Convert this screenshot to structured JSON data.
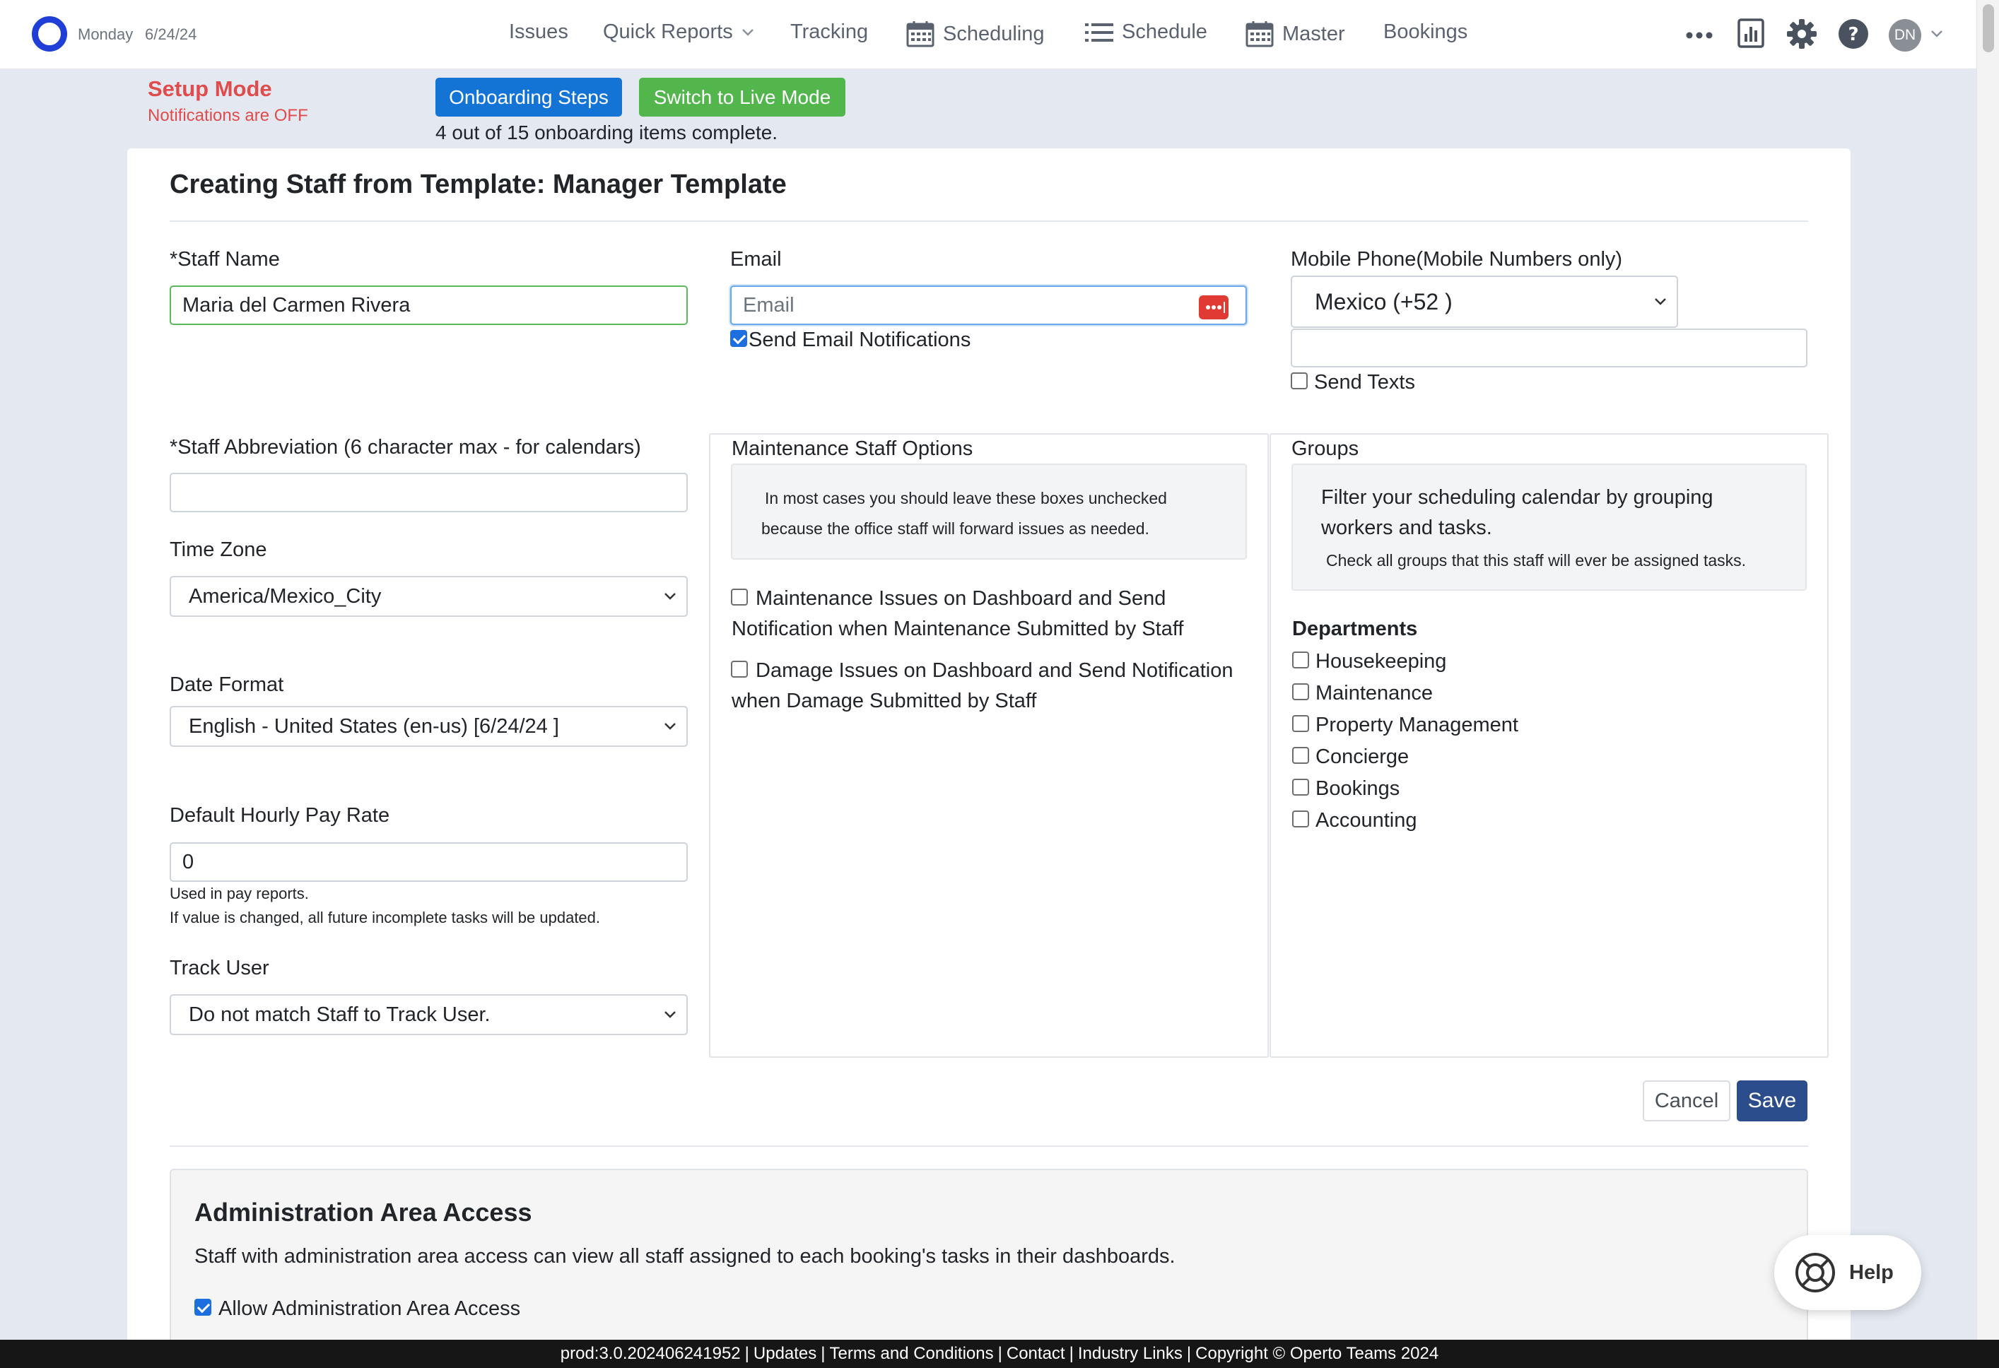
{
  "topnav": {
    "day": "Monday",
    "date": "6/24/24",
    "items": [
      {
        "label": "Issues"
      },
      {
        "label": "Quick Reports"
      },
      {
        "label": "Tracking"
      },
      {
        "label": "Scheduling"
      },
      {
        "label": "Schedule"
      },
      {
        "label": "Master"
      },
      {
        "label": "Bookings"
      }
    ],
    "avatar_initials": "DN"
  },
  "setup": {
    "title": "Setup Mode",
    "subtitle": "Notifications are OFF",
    "onboarding_button": "Onboarding Steps",
    "live_button": "Switch to Live Mode",
    "progress_text": "4 out of 15 onboarding items complete."
  },
  "form": {
    "title": "Creating Staff from Template: Manager Template",
    "staff_name": {
      "label": "*Staff Name",
      "value": "Maria del Carmen Rivera"
    },
    "email": {
      "label": "Email",
      "placeholder": "Email",
      "value": "",
      "notify_label": "Send Email Notifications",
      "notify_checked": true
    },
    "mobile": {
      "label": "Mobile Phone(Mobile Numbers only)",
      "country": "Mexico (+52 )",
      "number": "",
      "send_texts_label": "Send Texts",
      "send_texts_checked": false
    },
    "abbreviation": {
      "label": "*Staff Abbreviation (6 character max - for calendars)",
      "value": ""
    },
    "time_zone": {
      "label": "Time Zone",
      "value": "America/Mexico_City"
    },
    "date_format": {
      "label": "Date Format",
      "value": "English - United States (en-us) [6/24/24 ]"
    },
    "pay_rate": {
      "label": "Default Hourly Pay Rate",
      "value": "0",
      "help1": "Used in pay reports.",
      "help2": "If value is changed, all future incomplete tasks will be updated."
    },
    "track_user": {
      "label": "Track User",
      "value": "Do not match Staff to Track User."
    },
    "maintenance": {
      "title": "Maintenance Staff Options",
      "info_line1": "In most cases you should leave these boxes unchecked",
      "info_line2": "because the office staff will forward issues as needed.",
      "opt1_line1": "Maintenance Issues on Dashboard and Send",
      "opt1_line2": "Notification when Maintenance Submitted by Staff",
      "opt2_line1": "Damage Issues on Dashboard and Send Notification",
      "opt2_line2": "when Damage Submitted by Staff"
    },
    "groups": {
      "title": "Groups",
      "info_line1": "Filter your scheduling calendar by grouping",
      "info_line2": "workers and tasks.",
      "info_line3": "Check all groups that this staff will ever be assigned tasks.",
      "departments_heading": "Departments",
      "departments": [
        "Housekeeping",
        "Maintenance",
        "Property Management",
        "Concierge",
        "Bookings",
        "Accounting"
      ]
    },
    "cancel_button": "Cancel",
    "save_button": "Save"
  },
  "admin": {
    "title": "Administration Area Access",
    "description": "Staff with administration area access can view all staff assigned to each booking's tasks in their dashboards.",
    "allow_label": "Allow Administration Area Access",
    "allow_checked": true
  },
  "help": {
    "label": "Help"
  },
  "footer": {
    "version": "prod:3.0.202406241952",
    "links": [
      "Updates",
      "Terms and Conditions",
      "Contact",
      "Industry Links"
    ],
    "copyright": "Copyright © Operto Teams 2024"
  },
  "colors": {
    "brand_blue": "#1f3fd6",
    "setup_red": "#e04b4b",
    "onboarding_blue": "#1474d6",
    "live_green": "#52b64d",
    "save_navy": "#2b4d8c"
  },
  "icons": [
    "logo-icon",
    "chevron-down-icon",
    "calendar-icon",
    "list-icon",
    "more-icon",
    "report-icon",
    "gear-icon",
    "help-circle-icon",
    "password-manager-icon",
    "lifebuoy-icon"
  ]
}
